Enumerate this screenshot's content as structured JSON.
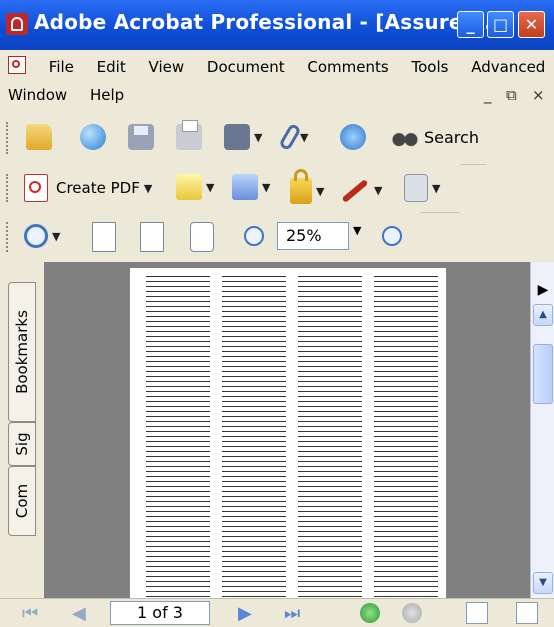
{
  "window": {
    "title": "Adobe Acrobat Professional - [Assurex-...",
    "minimize_glyph": "_",
    "maximize_glyph": "□",
    "close_glyph": "✕"
  },
  "menu": {
    "row1": [
      "File",
      "Edit",
      "View",
      "Document",
      "Comments",
      "Tools",
      "Advanced"
    ],
    "row2": [
      "Window",
      "Help"
    ],
    "doc_controls": {
      "minimize": "_",
      "restore": "⧉",
      "close": "×"
    }
  },
  "toolbar1": {
    "search_label": "Search",
    "icons": [
      "open-icon",
      "organizer-icon",
      "save-icon",
      "print-icon",
      "scan-icon",
      "attach-icon",
      "email-icon",
      "search-icon"
    ]
  },
  "toolbar2": {
    "create_pdf_label": "Create PDF",
    "icons": [
      "create-pdf-icon",
      "review-icon",
      "comment-icon",
      "secure-icon",
      "sign-icon",
      "forms-icon"
    ]
  },
  "toolbar3": {
    "zoom_value": "25%",
    "icons": [
      "zoom-in-icon",
      "actual-size-icon",
      "fit-page-icon",
      "fit-width-icon",
      "zoom-out-icon",
      "zoom-plus-icon"
    ]
  },
  "left_tabs": [
    "Bookmarks",
    "Sig",
    "Com"
  ],
  "statusbar": {
    "page_indicator": "1 of 3"
  }
}
